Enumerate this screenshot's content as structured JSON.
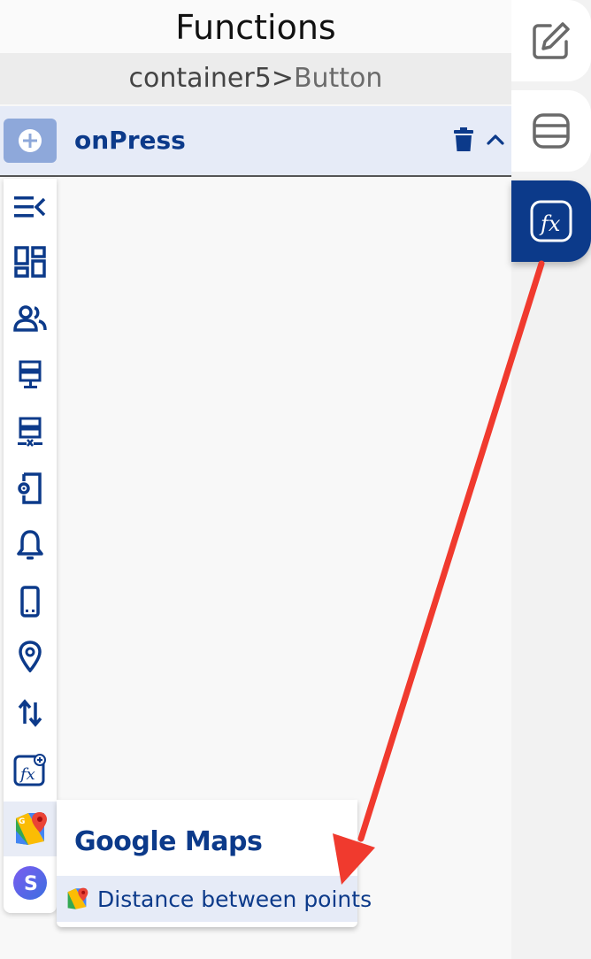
{
  "header": {
    "title": "Functions"
  },
  "breadcrumb": {
    "parent": "container5",
    "separator": ">",
    "child": "Button"
  },
  "event": {
    "label": "onPress",
    "add_icon": "plus-circle-icon",
    "delete_icon": "trash-icon",
    "collapse_icon": "chevron-up-icon"
  },
  "toolbar": {
    "items": [
      {
        "name": "menu-collapse-icon"
      },
      {
        "name": "dashboard-grid-icon"
      },
      {
        "name": "users-icon"
      },
      {
        "name": "server-add-icon"
      },
      {
        "name": "server-remove-icon"
      },
      {
        "name": "device-settings-icon"
      },
      {
        "name": "bell-icon"
      },
      {
        "name": "mobile-device-icon"
      },
      {
        "name": "location-pin-icon"
      },
      {
        "name": "transfer-arrows-icon"
      },
      {
        "name": "custom-function-icon"
      },
      {
        "name": "google-maps-icon"
      },
      {
        "name": "s-logo-icon"
      }
    ]
  },
  "popup": {
    "title": "Google Maps",
    "items": [
      {
        "label": "Distance between points",
        "icon": "google-maps-icon"
      }
    ]
  },
  "rail": {
    "tabs": [
      {
        "name": "edit-icon"
      },
      {
        "name": "database-icon"
      },
      {
        "name": "function-fx-icon"
      }
    ]
  },
  "colors": {
    "brand": "#0c3a8a",
    "highlight": "#e6ebf7",
    "arrow": "#f03a2e"
  }
}
